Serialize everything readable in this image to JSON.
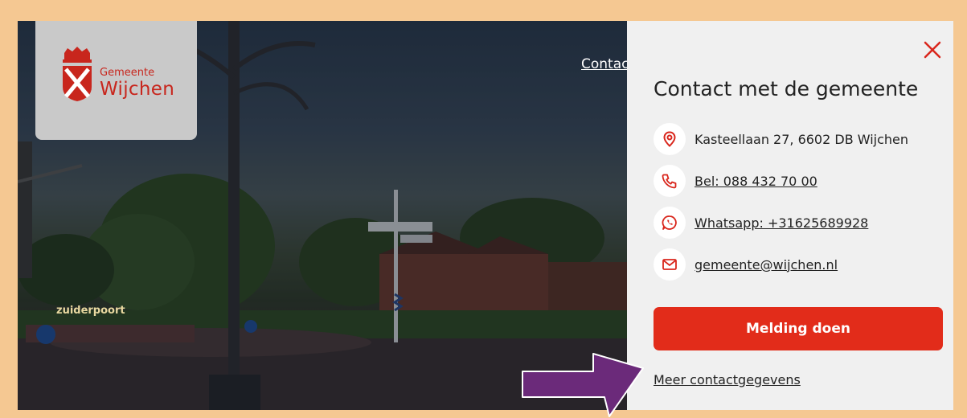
{
  "header": {
    "logo_small": "Gemeente",
    "logo_big": "Wijchen",
    "contact_link": "Contact"
  },
  "hero": {
    "sign_text": "zuiderpoort"
  },
  "panel": {
    "title": "Contact met de gemeente",
    "items": [
      {
        "icon": "location-pin-icon",
        "text": "Kasteellaan 27, 6602 DB Wijchen"
      },
      {
        "icon": "phone-icon",
        "text": "Bel: 088 432 70 00"
      },
      {
        "icon": "whatsapp-icon",
        "text": "Whatsapp: +31625689928"
      },
      {
        "icon": "mail-icon",
        "text": "gemeente@wijchen.nl"
      }
    ],
    "button_label": "Melding doen",
    "more_link": "Meer contactgegevens"
  },
  "colors": {
    "accent": "#e22c1a",
    "brand": "#c8261d",
    "border": "#f5c892",
    "annotation_arrow": "#6b2a7a"
  }
}
